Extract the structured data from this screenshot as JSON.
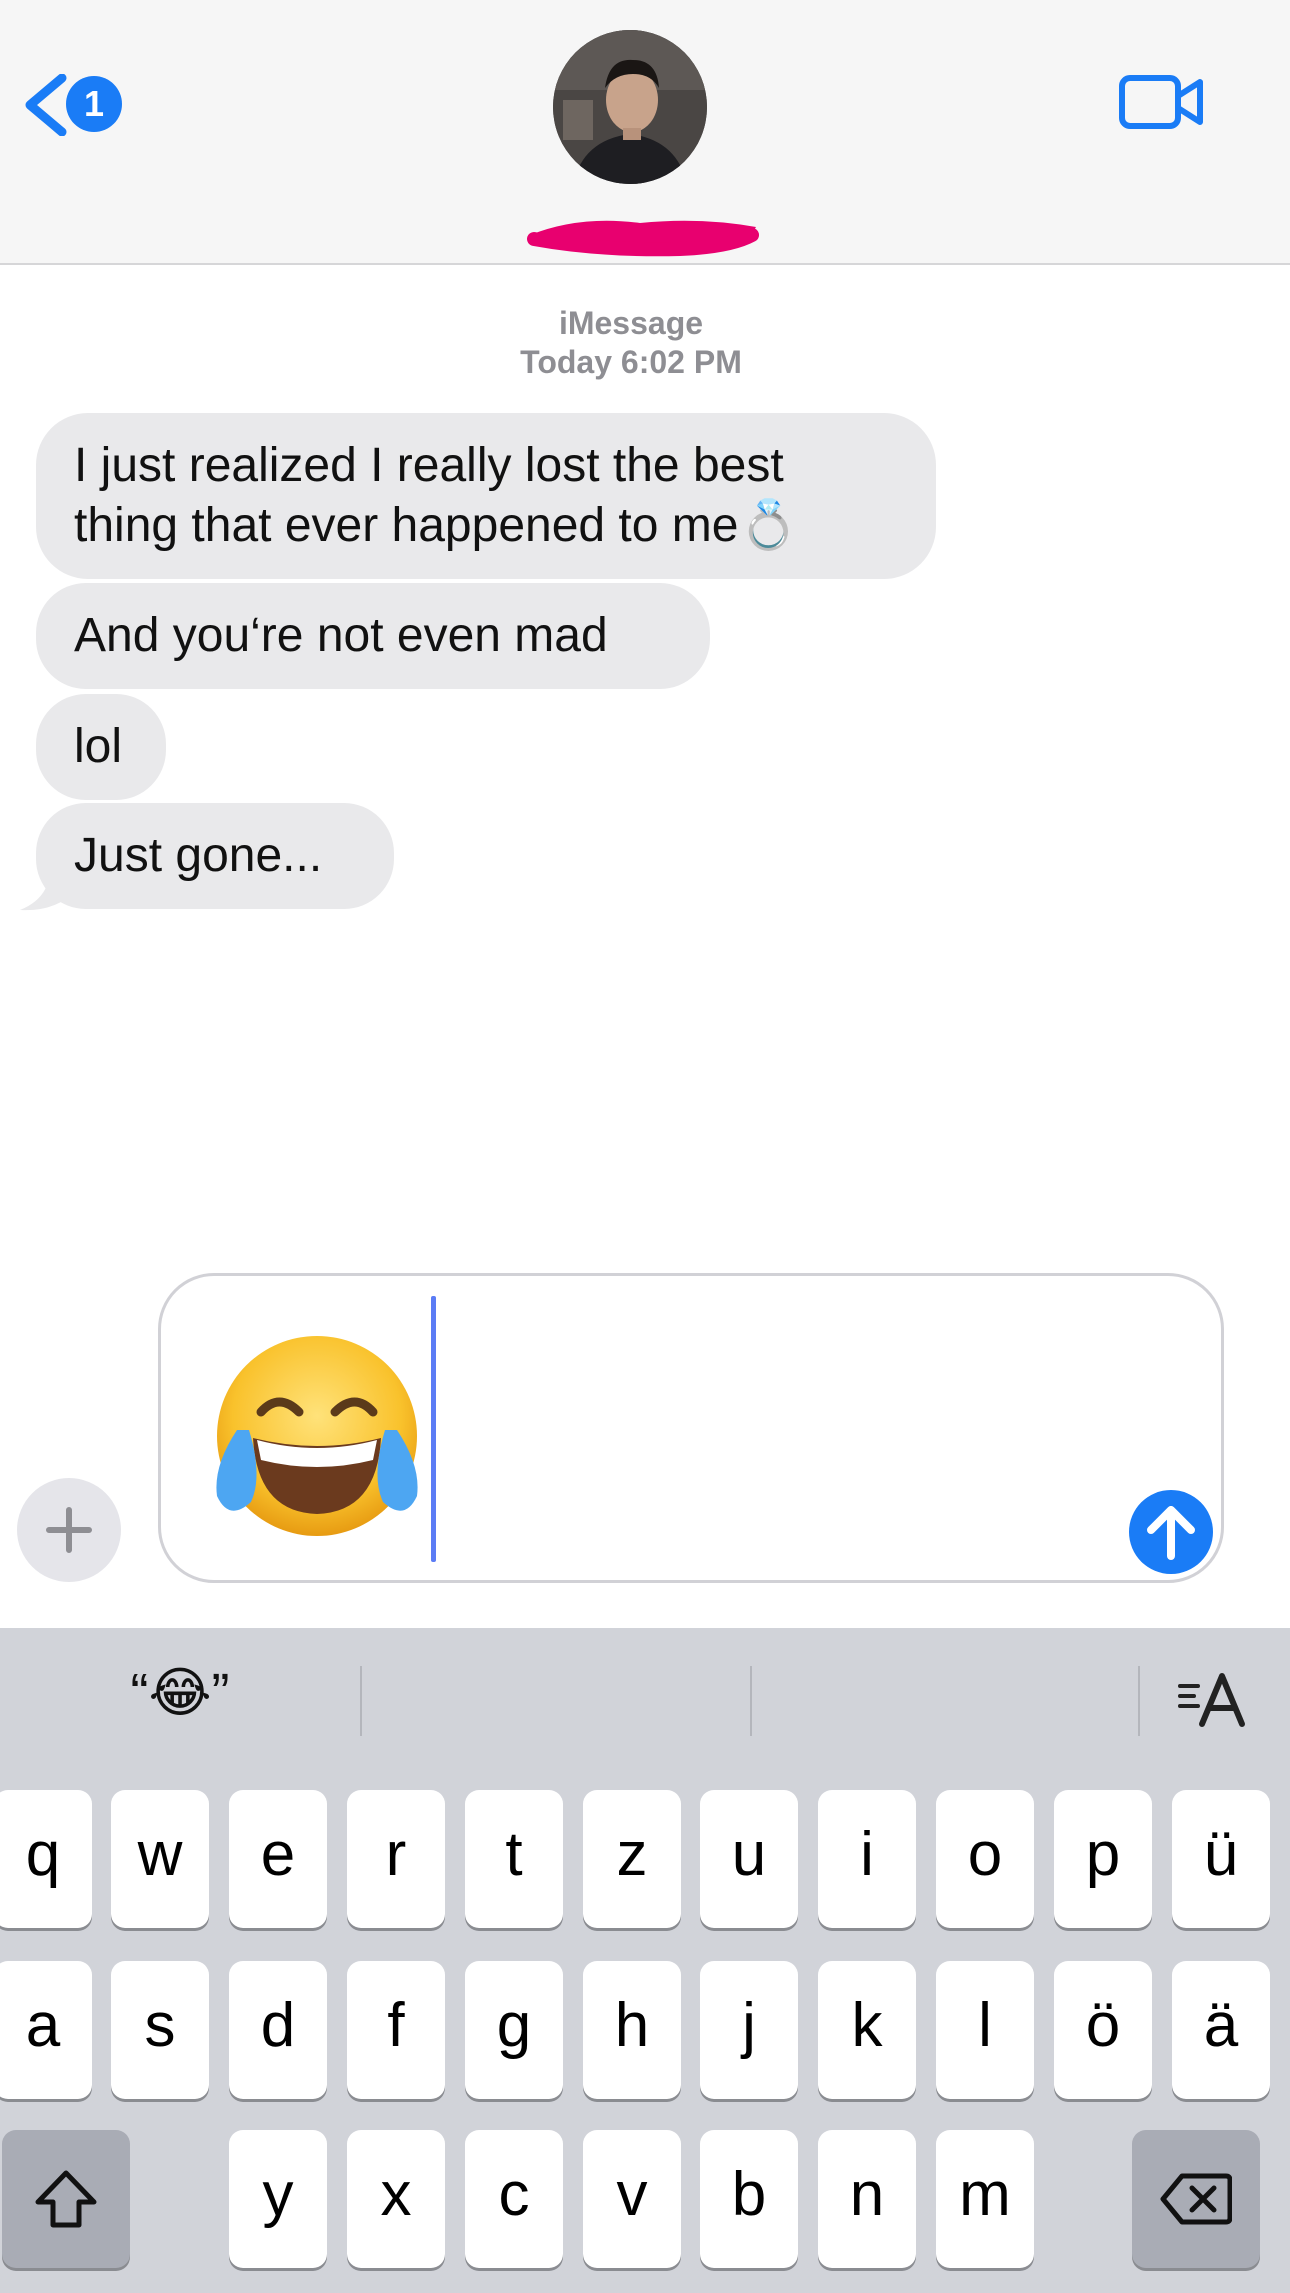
{
  "header": {
    "back_badge": "1",
    "colors": {
      "accent": "#1a7cf6",
      "scribble": "#e8006f"
    },
    "icons": [
      "chevron-left-icon",
      "video-camera-icon"
    ]
  },
  "conversation": {
    "service": "iMessage",
    "timestamp": "Today 6:02 PM",
    "messages": [
      {
        "text": "I just realized I really lost the best\nthing that ever happened to me💍"
      },
      {
        "text": "And you‘re not even mad"
      },
      {
        "text": "lol"
      },
      {
        "text": "Just gone..."
      }
    ]
  },
  "composer": {
    "draft": "😂",
    "icons": [
      "plus-icon",
      "send-arrow-icon"
    ]
  },
  "keyboard": {
    "suggestion": "“😂”",
    "row1": [
      "q",
      "w",
      "e",
      "r",
      "t",
      "z",
      "u",
      "i",
      "o",
      "p",
      "ü"
    ],
    "row2": [
      "a",
      "s",
      "d",
      "f",
      "g",
      "h",
      "j",
      "k",
      "l",
      "ö",
      "ä"
    ],
    "row3": [
      "y",
      "x",
      "c",
      "v",
      "b",
      "n",
      "m"
    ],
    "icons": [
      "shift-icon",
      "backspace-icon",
      "text-format-icon"
    ]
  }
}
